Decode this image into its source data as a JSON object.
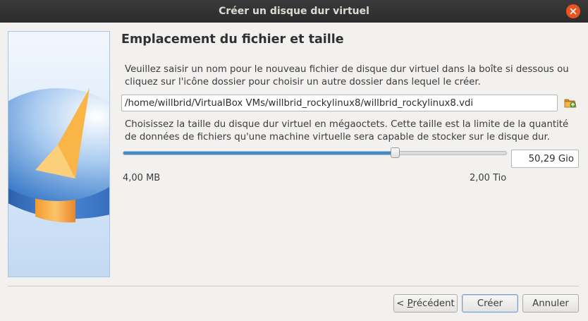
{
  "window": {
    "title": "Créer un disque dur virtuel"
  },
  "page": {
    "heading": "Emplacement du fichier et taille",
    "location_description": "Veuillez saisir un nom pour le nouveau fichier de disque dur virtuel dans la boîte si dessous ou cliquez sur l'icône dossier pour choisir un autre dossier dans lequel le créer.",
    "file_path": "/home/willbrid/VirtualBox VMs/willbrid_rockylinux8/willbrid_rockylinux8.vdi",
    "size_description": "Choisissez la taille du disque dur virtuel en mégaoctets. Cette taille est la limite de la quantité de données de fichiers qu'une machine virtuelle sera capable de stocker sur le disque dur.",
    "size_value": "50,29 Gio",
    "slider_fraction": 0.71,
    "range_min": "4,00 MB",
    "range_max": "2,00 Tio"
  },
  "buttons": {
    "back_prefix": "< ",
    "back_mnemonic": "P",
    "back_rest": "récédent",
    "create": "Créer",
    "cancel": "Annuler"
  },
  "icons": {
    "close": "close-icon",
    "folder": "folder-icon",
    "side_art": "hard-disk-illustration"
  },
  "colors": {
    "accent": "#e95420",
    "slider_fill": "#3d8ccf",
    "title_bar": "#2c2c2c"
  }
}
